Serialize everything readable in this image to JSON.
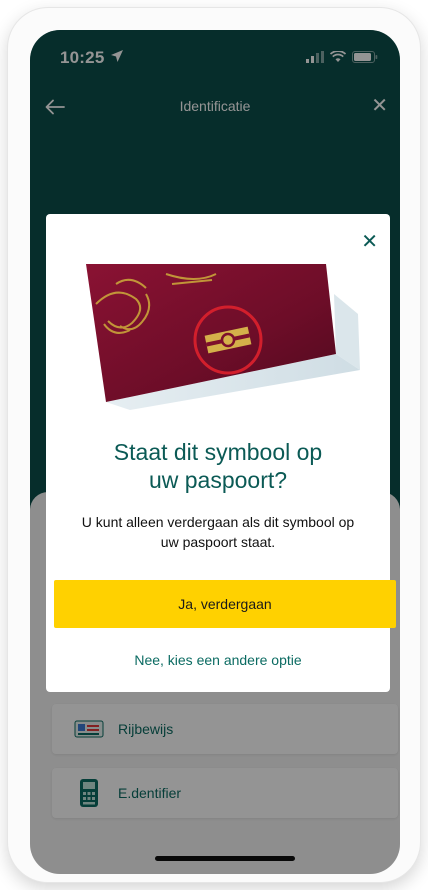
{
  "status_bar": {
    "time": "10:25"
  },
  "nav": {
    "title": "Identificatie",
    "close_label": "✕"
  },
  "options": [
    {
      "label": "Rijbewijs",
      "icon": "drivers-license-icon"
    },
    {
      "label": "E.dentifier",
      "icon": "edentifier-device-icon"
    }
  ],
  "modal": {
    "close_label": "✕",
    "title_line1": "Staat dit symbool op",
    "title_line2": "uw paspoort?",
    "body_line1": "U kunt alleen verdergaan als dit symbool op",
    "body_line2": "uw paspoort staat.",
    "primary_button": "Ja, verdergaan",
    "secondary_link": "Nee, kies een andere optie"
  },
  "colors": {
    "header": "#0b4f4a",
    "accent": "#0b6b62",
    "button": "#ffd100"
  }
}
